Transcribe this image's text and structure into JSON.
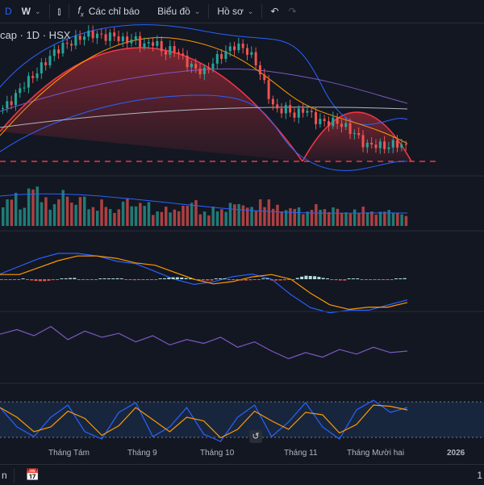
{
  "toolbar": {
    "interval_d": "D",
    "interval_w": "W",
    "indicators_label": "Các chỉ báo",
    "chart_label": "Biểu đồ",
    "profile_label": "Hồ sơ"
  },
  "symbol_legend": "cap · 1D · HSX",
  "x_axis": [
    "Tháng Tám",
    "Tháng 9",
    "Tháng 10",
    "Tháng 11",
    "Tháng Mười hai",
    "2026"
  ],
  "bottom": {
    "left_text": "n",
    "right_text": "1"
  },
  "colors": {
    "up": "#26a69a",
    "down": "#ef5350",
    "bg": "#131722",
    "arc": "#f23645"
  },
  "chart_data": {
    "type": "line",
    "title": "cap · 1D · HSX",
    "closes": [
      45,
      51,
      61,
      67,
      75,
      83,
      88,
      91,
      95,
      96,
      94,
      95,
      91,
      93,
      88,
      91,
      83,
      86,
      78,
      72,
      70,
      78,
      83,
      88,
      86,
      78,
      61,
      43,
      45,
      40,
      45,
      37,
      35,
      36,
      32,
      27,
      19,
      20,
      18,
      21,
      18
    ],
    "volume": [
      55,
      70,
      40,
      85,
      60,
      45,
      75,
      50,
      65,
      40,
      55,
      35,
      60,
      45,
      50,
      30,
      40,
      35,
      45,
      55,
      30,
      40,
      35,
      50,
      45,
      40,
      55,
      45,
      35,
      40,
      30,
      45,
      35,
      40,
      30,
      35,
      40,
      30,
      35,
      30,
      25
    ],
    "macd": [
      0.2,
      0.5,
      0.8,
      1.0,
      1.0,
      0.9,
      0.7,
      0.6,
      0.3,
      0.0,
      -0.2,
      -0.1,
      0.1,
      0.2,
      0.0,
      -0.6,
      -1.1,
      -1.3,
      -1.2,
      -1.2,
      -1.0,
      -0.8
    ],
    "rsi": [
      62,
      68,
      60,
      72,
      55,
      66,
      58,
      63,
      52,
      60,
      48,
      55,
      50,
      58,
      45,
      52,
      40,
      30,
      38,
      32,
      42,
      36,
      45,
      38,
      40
    ],
    "stoch": [
      80,
      40,
      20,
      60,
      85,
      30,
      15,
      70,
      90,
      20,
      40,
      80,
      25,
      10,
      60,
      85,
      20,
      50,
      90,
      40,
      15,
      75,
      95,
      70,
      80
    ]
  }
}
